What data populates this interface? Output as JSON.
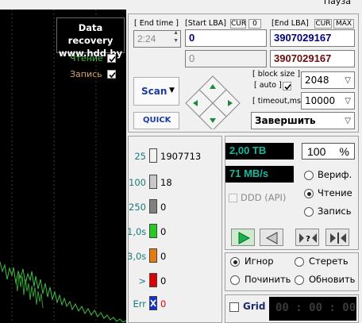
{
  "titlebar": {
    "pause_label": "Пауза"
  },
  "graph": {
    "watermark_line1": "Data recovery",
    "watermark_line2": "www.hdd.by",
    "read_label": "Чтение",
    "read_checked": true,
    "write_label": "Запись",
    "write_checked": true,
    "colors": {
      "read": "#40c040",
      "write": "#d9a06a",
      "background": "#000000"
    }
  },
  "time": {
    "label": "[ End time ]",
    "value": "2:24"
  },
  "lba": {
    "start_label": "[Start LBA]",
    "cur_label": "CUR",
    "cur_value": "0",
    "end_label": "[End LBA]",
    "end_cur_label": "CUR",
    "max_label": "MAX",
    "start_value": "0",
    "end_value": "3907029167",
    "start_current": "0",
    "end_current": "3907029167"
  },
  "block": {
    "block_size_label": "[ block size ]",
    "auto_label": "[ auto ]",
    "auto_checked": true,
    "block_size_value": "2048",
    "timeout_label": "[ timeout,ms ]",
    "timeout_value": "10000"
  },
  "actions": {
    "scan_label": "Scan",
    "quick_label": "QUICK",
    "finish_label": "Завершить"
  },
  "stats": {
    "rows": [
      {
        "label": "25",
        "value": "1907713",
        "color": "#f2f2f2"
      },
      {
        "label": "100",
        "value": "18",
        "color": "#c8c8c8"
      },
      {
        "label": "250",
        "value": "0",
        "color": "#808080"
      },
      {
        "label": "1,0s",
        "value": "0",
        "color": "#22cc22"
      },
      {
        "label": "3,0s",
        "value": "0",
        "color": "#e87a10"
      },
      {
        "label": ">",
        "value": "0",
        "color": "#e00000"
      },
      {
        "label": "Err",
        "value": "0",
        "color": "#1030d0"
      }
    ]
  },
  "status": {
    "size": "2,00 TB",
    "percent": "100",
    "percent_sign": "%",
    "speed": "71 MB/s",
    "ddd_label": "DDD (API)",
    "verify_label": "Вериф.",
    "read_label": "Чтение",
    "write_label": "Запись",
    "mode_selected": "Чтение"
  },
  "errors": {
    "ignore_label": "Игнор",
    "erase_label": "Стереть",
    "repair_label": "Починить",
    "refresh_label": "Обновить",
    "selected": "Игнор"
  },
  "grid": {
    "label": "Grid",
    "checked": false,
    "timer": "00 : 00 : 00"
  }
}
